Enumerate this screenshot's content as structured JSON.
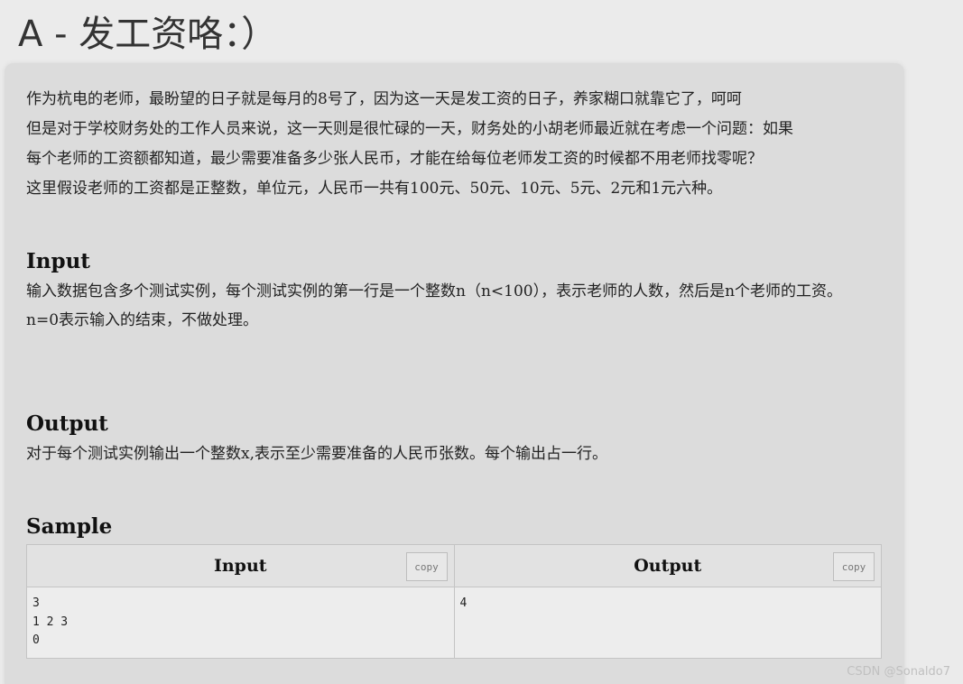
{
  "problem": {
    "title": "A - 发工资咯：）",
    "description": [
      "作为杭电的老师，最盼望的日子就是每月的8号了，因为这一天是发工资的日子，养家糊口就靠它了，呵呵",
      "但是对于学校财务处的工作人员来说，这一天则是很忙碌的一天，财务处的小胡老师最近就在考虑一个问题：如果",
      "每个老师的工资额都知道，最少需要准备多少张人民币，才能在给每位老师发工资的时候都不用老师找零呢？",
      "这里假设老师的工资都是正整数，单位元，人民币一共有100元、50元、10元、5元、2元和1元六种。"
    ]
  },
  "input_section": {
    "title": "Input",
    "lines": [
      "输入数据包含多个测试实例，每个测试实例的第一行是一个整数n（n<100），表示老师的人数，然后是n个老师的工资。",
      "n=0表示输入的结束，不做处理。"
    ]
  },
  "output_section": {
    "title": "Output",
    "lines": [
      "对于每个测试实例输出一个整数x,表示至少需要准备的人民币张数。每个输出占一行。"
    ]
  },
  "sample": {
    "title": "Sample",
    "input_header": "Input",
    "output_header": "Output",
    "copy_label": "copy",
    "input_text": "3\n1 2 3\n0",
    "output_text": "4"
  },
  "watermark": "CSDN @Sonaldo7"
}
